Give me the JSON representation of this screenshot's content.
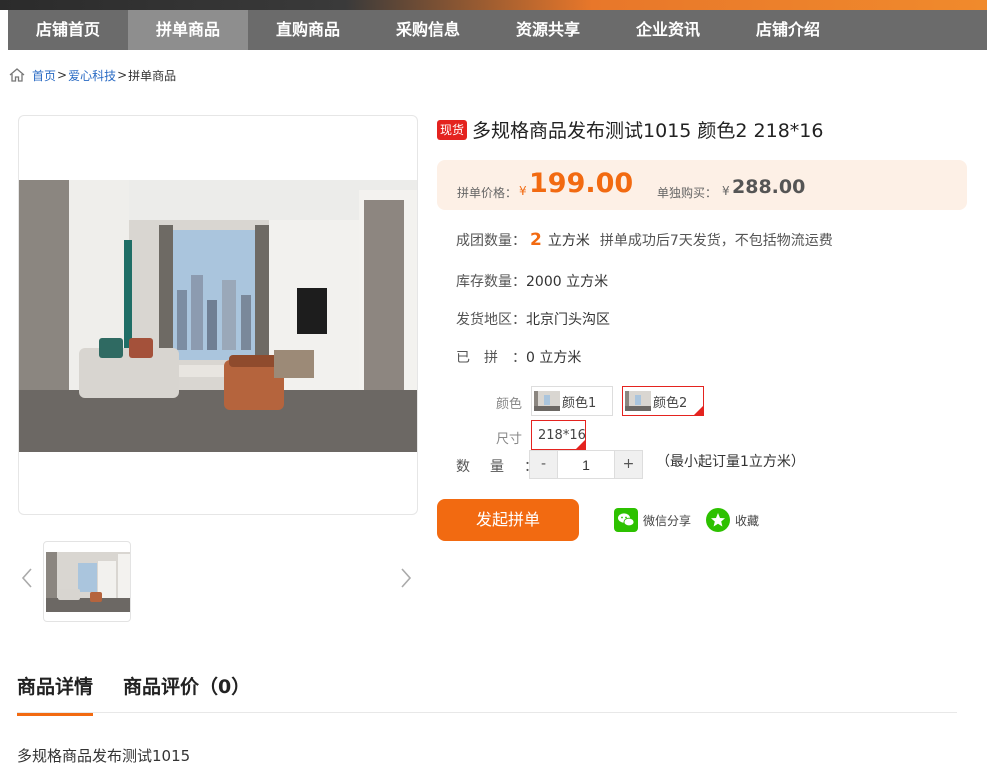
{
  "nav": {
    "items": [
      {
        "label": "店铺首页",
        "active": false
      },
      {
        "label": "拼单商品",
        "active": true
      },
      {
        "label": "直购商品",
        "active": false
      },
      {
        "label": "采购信息",
        "active": false
      },
      {
        "label": "资源共享",
        "active": false
      },
      {
        "label": "企业资讯",
        "active": false
      },
      {
        "label": "店铺介绍",
        "active": false
      }
    ]
  },
  "breadcrumb": {
    "home": "首页",
    "sep1": ">",
    "shop": "爱心科技",
    "sep2": ">",
    "current": "拼单商品"
  },
  "product": {
    "stock_tag": "现货",
    "title": "多规格商品发布测试1015 颜色2 218*16",
    "price": {
      "group_label": "拼单价格：",
      "group_currency": "¥",
      "group_value": "199.00",
      "solo_label": "单独购买：",
      "solo_currency": "¥",
      "solo_value": "288.00"
    },
    "group_qty": {
      "label": "成团数量：",
      "value": "2",
      "unit": "立方米",
      "note": "拼单成功后7天发货，不包括物流运费"
    },
    "stock": {
      "label": "库存数量：",
      "value": "2000 立方米"
    },
    "ship_from": {
      "label": "发货地区：",
      "value": "北京门头沟区"
    },
    "grouped": {
      "label": "已　拼　：",
      "value": "0 立方米"
    },
    "options": {
      "color_label": "颜色",
      "colors": [
        {
          "label": "颜色1",
          "selected": false
        },
        {
          "label": "颜色2",
          "selected": true
        }
      ],
      "size_label": "尺寸",
      "sizes": [
        {
          "label": "218*16",
          "selected": true
        }
      ]
    },
    "quantity": {
      "label": "数　量　：",
      "minus": "-",
      "value": "1",
      "plus": "+",
      "min_order": "（最小起订量1立方米）"
    },
    "actions": {
      "start_group": "发起拼单",
      "share": "微信分享",
      "favorite": "收藏"
    }
  },
  "tabs": [
    {
      "label": "商品详情",
      "active": true
    },
    {
      "label": "商品评价（0）",
      "active": false
    }
  ],
  "detail": {
    "text": "多规格商品发布测试1015"
  },
  "colors": {
    "accent": "#f26a11",
    "nav_bg": "#6b6b6b",
    "nav_active": "#8e8e8e",
    "tag_red": "#e4231f",
    "link": "#2a6bc4",
    "price_bg": "#fdf0e6",
    "wechat_green": "#2dc100"
  },
  "icons": [
    "home-icon",
    "chevron-left-icon",
    "chevron-right-icon",
    "wechat-icon",
    "star-icon"
  ]
}
